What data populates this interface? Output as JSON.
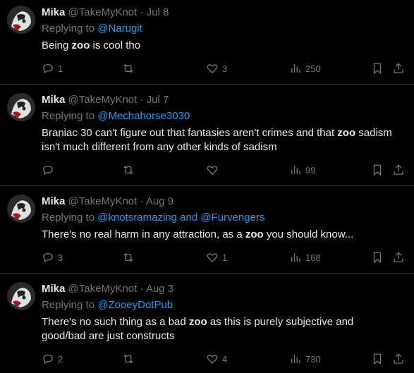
{
  "tweets": [
    {
      "name": "Mika",
      "handle": "@TakeMyKnot",
      "sep": "·",
      "date": "Jul 8",
      "reply_prefix": "Replying to",
      "reply_to": "@Narugit",
      "text_parts": [
        {
          "t": "Being ",
          "b": false
        },
        {
          "t": "zoo",
          "b": true
        },
        {
          "t": " is cool tho",
          "b": false
        }
      ],
      "counts": {
        "replies": "1",
        "retweets": "",
        "likes": "3",
        "views": "250"
      }
    },
    {
      "name": "Mika",
      "handle": "@TakeMyKnot",
      "sep": "·",
      "date": "Jul 7",
      "reply_prefix": "Replying to",
      "reply_to": "@Mechahorse3030",
      "text_parts": [
        {
          "t": "Braniac 30 can't figure out that fantasies aren't crimes and that ",
          "b": false
        },
        {
          "t": "zoo",
          "b": true
        },
        {
          "t": " sadism isn't much different from any other kinds of sadism",
          "b": false
        }
      ],
      "counts": {
        "replies": "",
        "retweets": "",
        "likes": "",
        "views": "99"
      }
    },
    {
      "name": "Mika",
      "handle": "@TakeMyKnot",
      "sep": "·",
      "date": "Aug 9",
      "reply_prefix": "Replying to",
      "reply_to": "@knotsramazing and @Furvengers",
      "text_parts": [
        {
          "t": "There's no real harm in any attraction, as a ",
          "b": false
        },
        {
          "t": "zoo",
          "b": true
        },
        {
          "t": " you should know...",
          "b": false
        }
      ],
      "counts": {
        "replies": "3",
        "retweets": "",
        "likes": "1",
        "views": "168"
      }
    },
    {
      "name": "Mika",
      "handle": "@TakeMyKnot",
      "sep": "·",
      "date": "Aug 3",
      "reply_prefix": "Replying to",
      "reply_to": "@ZooeyDotPub",
      "text_parts": [
        {
          "t": "There's no such thing as a bad ",
          "b": false
        },
        {
          "t": "zoo",
          "b": true
        },
        {
          "t": " as this is purely subjective and good/bad are just constructs",
          "b": false
        }
      ],
      "counts": {
        "replies": "2",
        "retweets": "",
        "likes": "4",
        "views": "730"
      }
    }
  ],
  "icons": {
    "reply": "reply-icon",
    "retweet": "retweet-icon",
    "like": "like-icon",
    "views": "views-icon",
    "bookmark": "bookmark-icon",
    "share": "share-icon"
  },
  "colors": {
    "background": "#000000",
    "text": "#e7e9ea",
    "muted": "#71767b",
    "link": "#1d9bf0",
    "divider": "#2f3336"
  }
}
